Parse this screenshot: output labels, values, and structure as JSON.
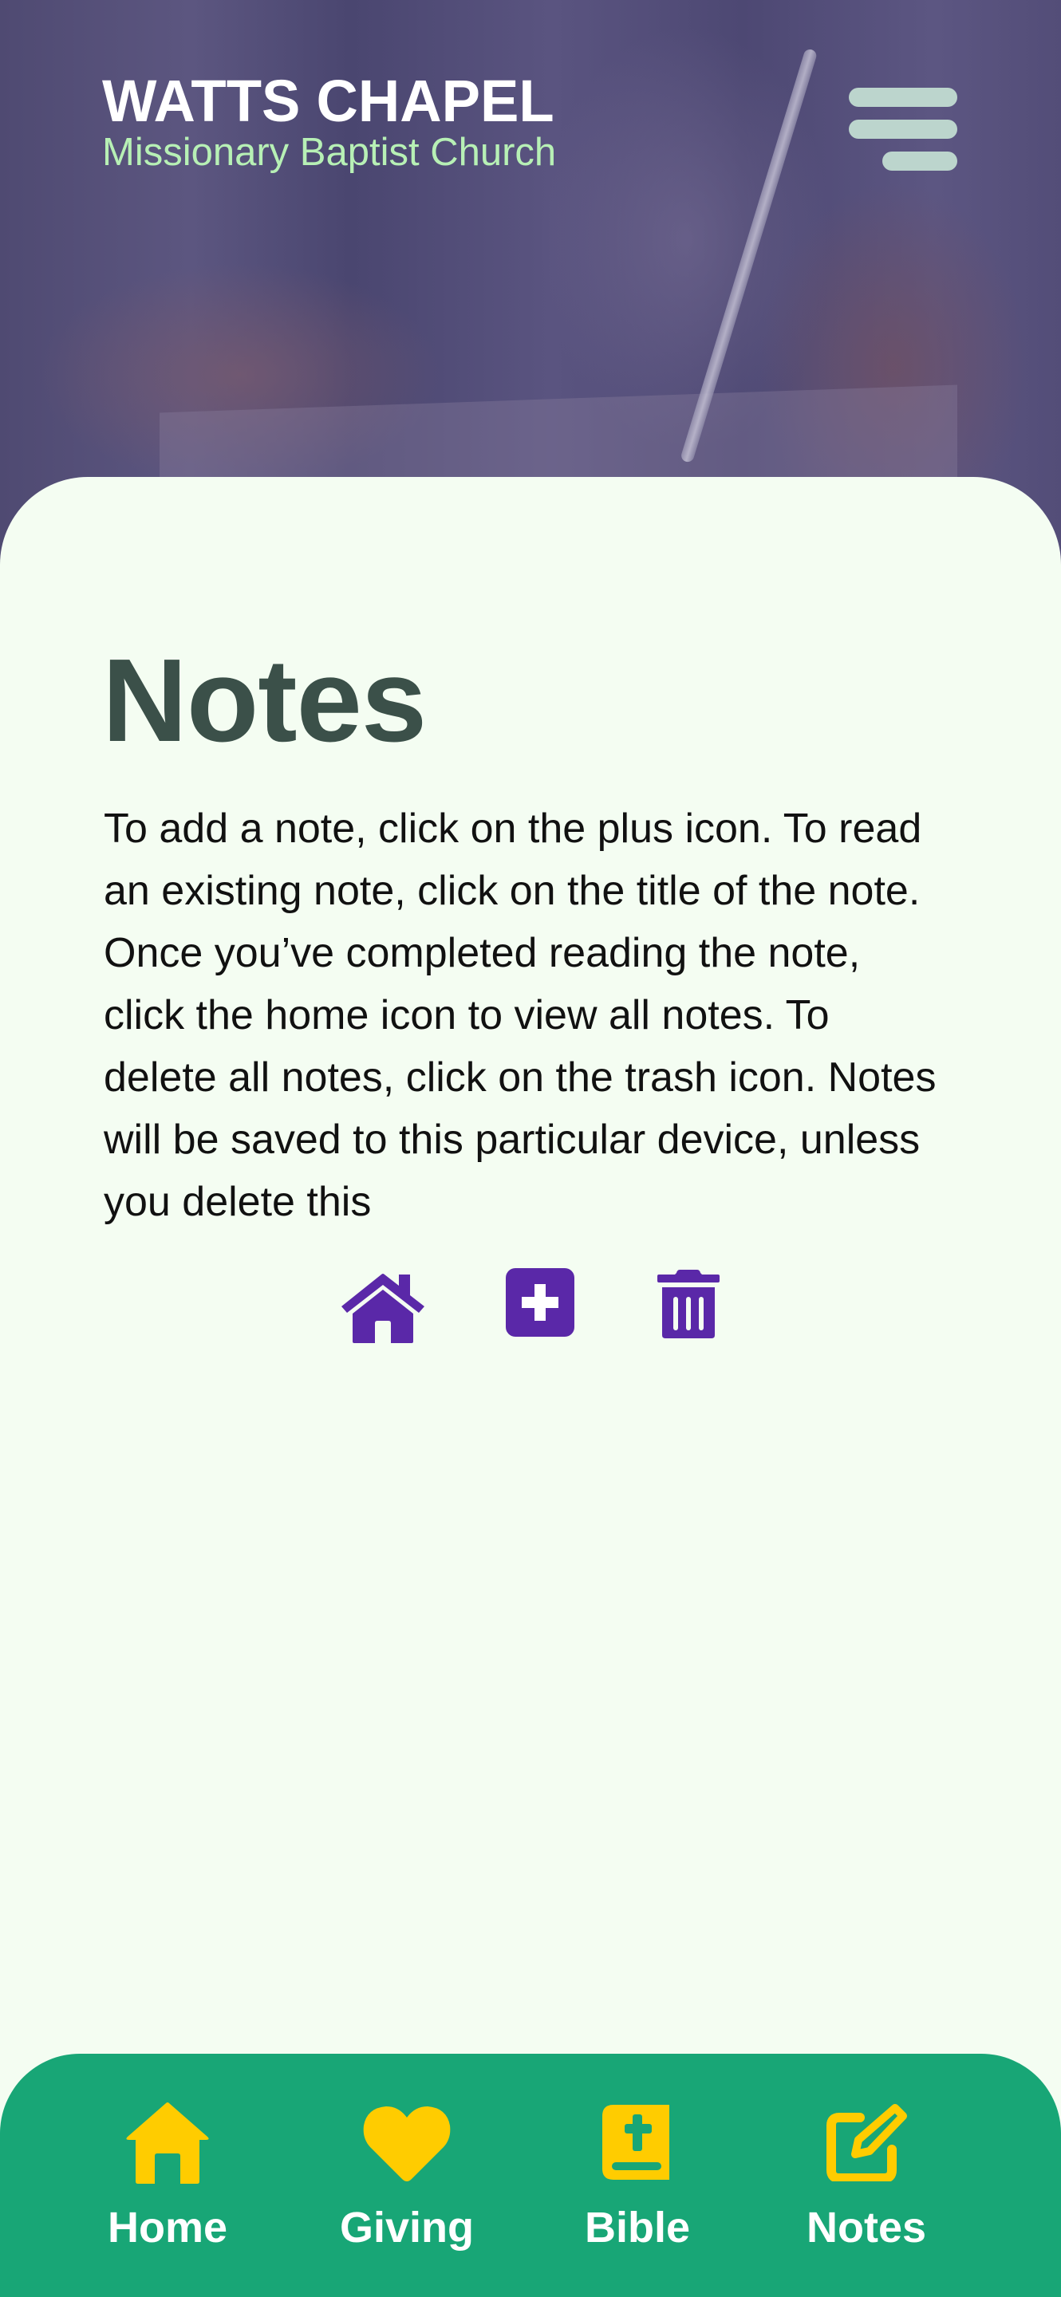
{
  "header": {
    "title": "WATTS CHAPEL",
    "subtitle": "Missionary Baptist Church",
    "menu_icon": "hamburger-menu-icon"
  },
  "main": {
    "title": "Notes",
    "instructions": "To add a note, click on the plus icon. To read an existing note, click on the title of the note. Once you’ve completed reading the note, click the home icon to view all notes. To delete all notes, click on the trash icon. Notes will be saved to this particular device, unless you delete this",
    "actions": [
      {
        "name": "home",
        "icon": "home-icon"
      },
      {
        "name": "add-note",
        "icon": "plus-square-icon"
      },
      {
        "name": "delete-all",
        "icon": "trash-icon"
      }
    ]
  },
  "bottom_nav": {
    "items": [
      {
        "label": "Home",
        "icon": "home-icon"
      },
      {
        "label": "Giving",
        "icon": "heart-icon"
      },
      {
        "label": "Bible",
        "icon": "bible-icon"
      },
      {
        "label": "Notes",
        "icon": "edit-note-icon"
      }
    ]
  },
  "colors": {
    "brand_subtitle": "#b7f0b5",
    "page_background": "#f4fdf2",
    "title_text": "#3b5049",
    "action_icons": "#5a28a8",
    "nav_background": "#18a676",
    "nav_icons": "#ffcc00",
    "nav_labels": "#ffffff",
    "menu_bars": "#bcd5cd"
  }
}
